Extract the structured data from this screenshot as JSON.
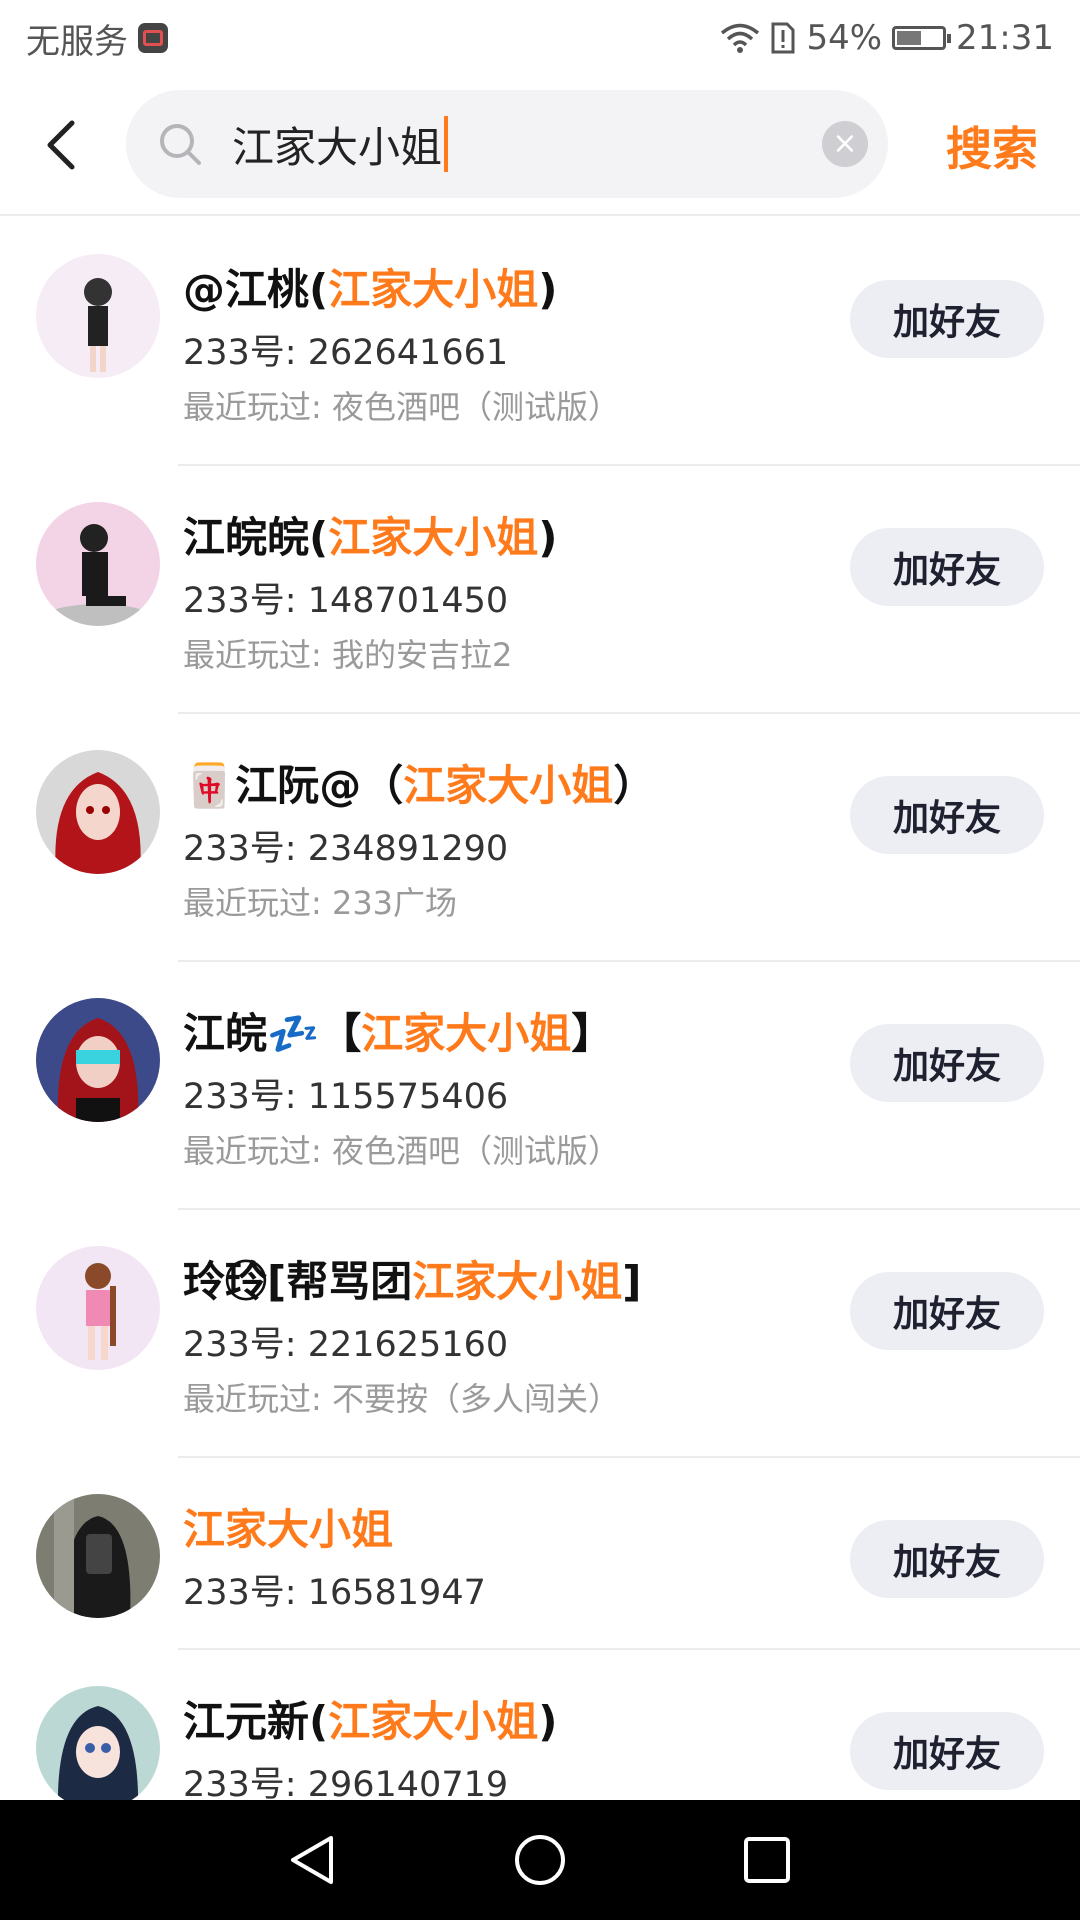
{
  "status_bar": {
    "carrier": "无服务",
    "battery": "54%",
    "battery_level": 0.54,
    "time": "21:31"
  },
  "search": {
    "query": "江家大小姐",
    "button_label": "搜索"
  },
  "accent_color": "#ff7a1a",
  "results": [
    {
      "name_prefix": "@江桃(",
      "name_highlight": "江家大小姐",
      "name_suffix": ")",
      "uid": "233号: 262641661",
      "recent": "最近玩过: 夜色酒吧（测试版）",
      "button": "加好友"
    },
    {
      "name_prefix": "江皖皖(",
      "name_highlight": "江家大小姐",
      "name_suffix": ")",
      "uid": "233号: 148701450",
      "recent": "最近玩过: 我的安吉拉2",
      "button": "加好友"
    },
    {
      "name_prefix": "🀄江阮@（",
      "name_highlight": "江家大小姐",
      "name_suffix": "）",
      "uid": "233号: 234891290",
      "recent": "最近玩过: 233广场",
      "button": "加好友"
    },
    {
      "name_prefix": "江皖💤【",
      "name_highlight": "江家大小姐",
      "name_suffix": "】",
      "uid": "233号: 115575406",
      "recent": "最近玩过: 夜色酒吧（测试版）",
      "button": "加好友"
    },
    {
      "name_prefix": "玲玲⃝[帮骂团",
      "name_highlight": "江家大小姐",
      "name_suffix": "]",
      "uid": "233号: 221625160",
      "recent": "最近玩过: 不要按（多人闯关）",
      "button": "加好友"
    },
    {
      "name_prefix": "",
      "name_highlight": "江家大小姐",
      "name_suffix": "",
      "uid": "233号: 16581947",
      "recent": "",
      "button": "加好友"
    },
    {
      "name_prefix": "江元新(",
      "name_highlight": "江家大小姐",
      "name_suffix": ")",
      "uid": "233号: 296140719",
      "recent": "",
      "button": "加好友"
    }
  ]
}
